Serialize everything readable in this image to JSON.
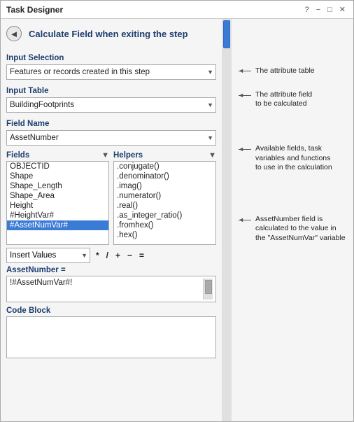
{
  "window": {
    "title": "Task Designer",
    "controls": [
      "?",
      "−",
      "□",
      "✕"
    ]
  },
  "header": {
    "back_label": "◄",
    "title": "Calculate Field when exiting the step"
  },
  "input_selection": {
    "label": "Input Selection",
    "value": "Features or records created in this step",
    "options": [
      "Features or records created in this step"
    ]
  },
  "input_table": {
    "label": "Input Table",
    "value": "BuildingFootprints",
    "options": [
      "BuildingFootprints"
    ]
  },
  "field_name": {
    "label": "Field Name",
    "value": "AssetNumber",
    "options": [
      "AssetNumber"
    ]
  },
  "fields": {
    "label": "Fields",
    "items": [
      "OBJECTID",
      "Shape",
      "Shape_Length",
      "Shape_Area",
      "Height",
      "#HeightVar#",
      "#AssetNumVar#"
    ]
  },
  "helpers": {
    "label": "Helpers",
    "items": [
      ".conjugate()",
      ".denominator()",
      ".imag()",
      ".numerator()",
      ".real()",
      ".as_integer_ratio()",
      ".fromhex()",
      ".hex()"
    ]
  },
  "insert_values": {
    "label": "Insert Values",
    "options": [
      "Insert Values"
    ]
  },
  "operators": [
    "*",
    "/",
    "+",
    "−",
    "="
  ],
  "expression": {
    "label": "AssetNumber =",
    "value": "!#AssetNumVar#!"
  },
  "code_block": {
    "label": "Code Block"
  },
  "notes": {
    "attribute_table": "The attribute table",
    "attribute_field": "The attribute field\nto be calculated",
    "available_fields": "Available fields, task\nvariables and functions\nto use in the calculation",
    "asset_number": "AssetNumber field is\ncalculated to the value in\nthe \"AssetNumVar\" variable"
  }
}
